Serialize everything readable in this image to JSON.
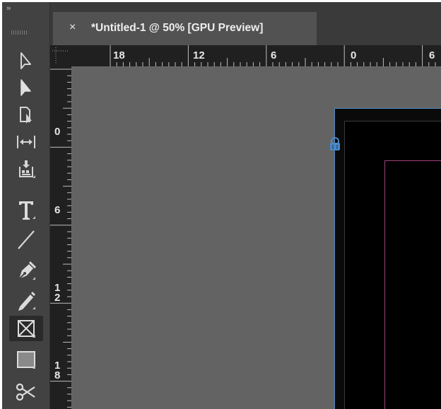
{
  "document_tab": {
    "close_label": "×",
    "title": "*Untitled-1 @ 50% [GPU Preview]"
  },
  "toolbar": {
    "collapse_label": "››",
    "tools": [
      {
        "name": "selection-tool",
        "icon": "selection-arrow-icon"
      },
      {
        "name": "direct-selection-tool",
        "icon": "direct-selection-arrow-icon"
      },
      {
        "name": "page-tool",
        "icon": "page-tool-icon"
      },
      {
        "name": "gap-tool",
        "icon": "gap-tool-icon"
      },
      {
        "name": "content-collector-tool",
        "icon": "content-collector-icon"
      },
      {
        "name": "type-tool",
        "icon": "type-tool-icon",
        "label": "T"
      },
      {
        "name": "line-tool",
        "icon": "line-tool-icon"
      },
      {
        "name": "pen-tool",
        "icon": "pen-tool-icon"
      },
      {
        "name": "pencil-tool",
        "icon": "pencil-tool-icon"
      },
      {
        "name": "rectangle-frame-tool",
        "icon": "rectangle-frame-icon",
        "active": true
      },
      {
        "name": "rectangle-tool",
        "icon": "rectangle-tool-icon"
      },
      {
        "name": "scissors-tool",
        "icon": "scissors-icon"
      }
    ]
  },
  "horizontal_ruler": {
    "labels": [
      "18",
      "12",
      "6",
      "0",
      "6"
    ]
  },
  "vertical_ruler": {
    "labels": [
      "0",
      "6",
      "12",
      "18"
    ],
    "label_lines": [
      [
        "0"
      ],
      [
        "6"
      ],
      [
        "1",
        "2"
      ],
      [
        "1",
        "8"
      ]
    ]
  },
  "colors": {
    "page_edge": "#4a88c4",
    "margin_guide": "#a0407a",
    "pasteboard": "#636363"
  }
}
